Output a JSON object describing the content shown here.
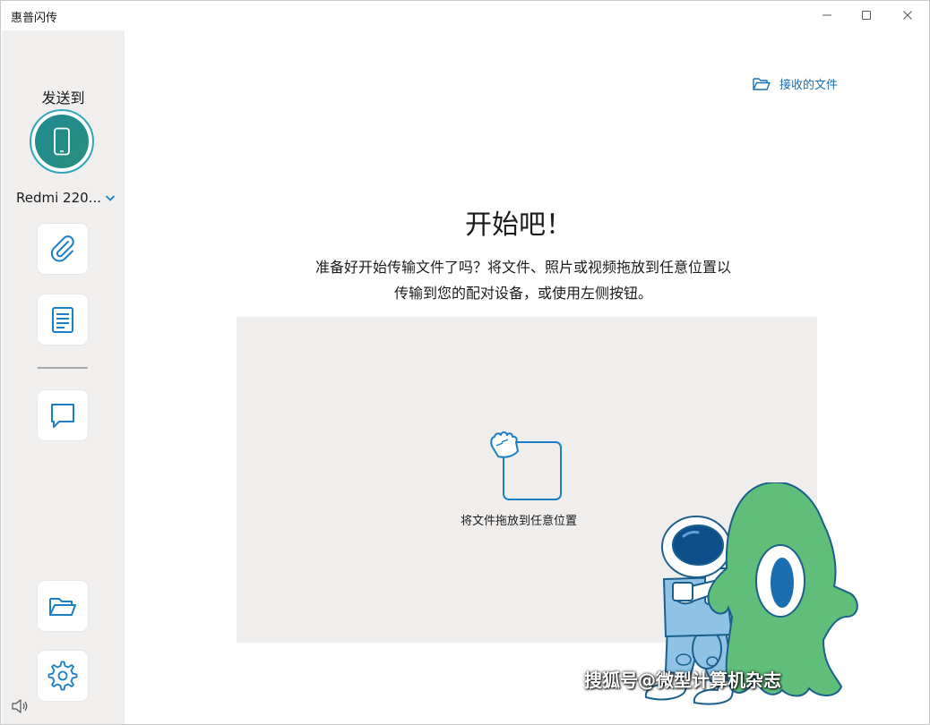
{
  "window": {
    "title": "惠普闪传",
    "controls": {
      "minimize": "minimize-icon",
      "maximize": "maximize-icon",
      "close": "close-icon"
    }
  },
  "sidebar": {
    "send_to_label": "发送到",
    "device_name": "Redmi 220...",
    "buttons": [
      {
        "icon": "paperclip-icon"
      },
      {
        "icon": "document-icon"
      },
      {
        "icon": "message-icon"
      },
      {
        "icon": "folder-icon"
      },
      {
        "icon": "gear-icon"
      }
    ],
    "volume_icon": "volume-icon"
  },
  "main": {
    "received_files_label": "接收的文件",
    "heading": "开始吧！",
    "subtitle": "准备好开始传输文件了吗？将文件、照片或视频拖放到任意位置以传输到您的配对设备，或使用左侧按钮。",
    "dropzone_label": "将文件拖放到任意位置"
  },
  "watermark": "搜狐号@微型计算机杂志",
  "colors": {
    "accent": "#1a6fb0",
    "icon_blue": "#1b7fc4",
    "sidebar_bg": "#f1efee",
    "dropzone_bg": "#efeeed",
    "avatar_teal": "#1f8a93",
    "alien_green": "#5fbf7a"
  }
}
